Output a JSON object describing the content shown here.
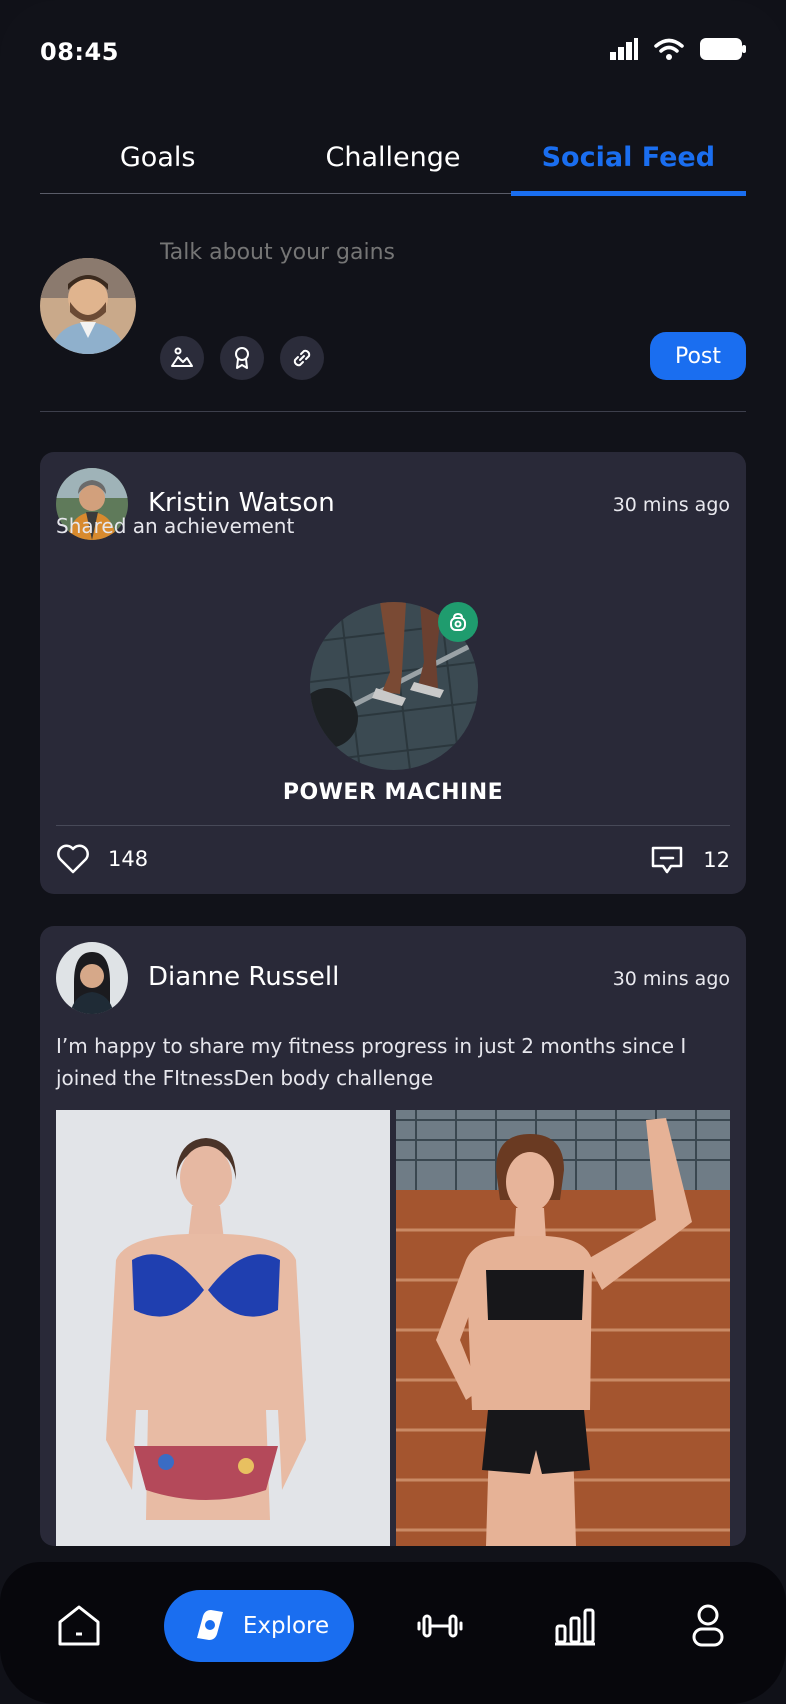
{
  "status_bar": {
    "time": "08:45"
  },
  "tabs": [
    {
      "label": "Goals",
      "active": false
    },
    {
      "label": "Challenge",
      "active": false
    },
    {
      "label": "Social Feed",
      "active": true
    }
  ],
  "composer": {
    "placeholder": "Talk about your gains",
    "tools": [
      "image-icon",
      "award-icon",
      "link-icon"
    ],
    "post_label": "Post"
  },
  "posts": [
    {
      "author": "Kristin Watson",
      "time": "30 mins ago",
      "text": "Shared an achievement",
      "achievement_title": "POWER MACHINE",
      "likes": "148",
      "comments": "12"
    },
    {
      "author": "Dianne Russell",
      "time": "30 mins ago",
      "text_line1": "I’m happy to share my fitness progress in just 2 months since I",
      "text_line2": "joined the FItnessDen body challenge"
    }
  ],
  "bottom_nav": {
    "explore_label": "Explore",
    "items": [
      "home-icon",
      "explore-icon",
      "dumbbell-icon",
      "stats-icon",
      "profile-icon"
    ]
  },
  "colors": {
    "accent": "#1a6ef0",
    "background": "#111219",
    "card": "#292938",
    "badge_green": "#1f9c6e"
  }
}
